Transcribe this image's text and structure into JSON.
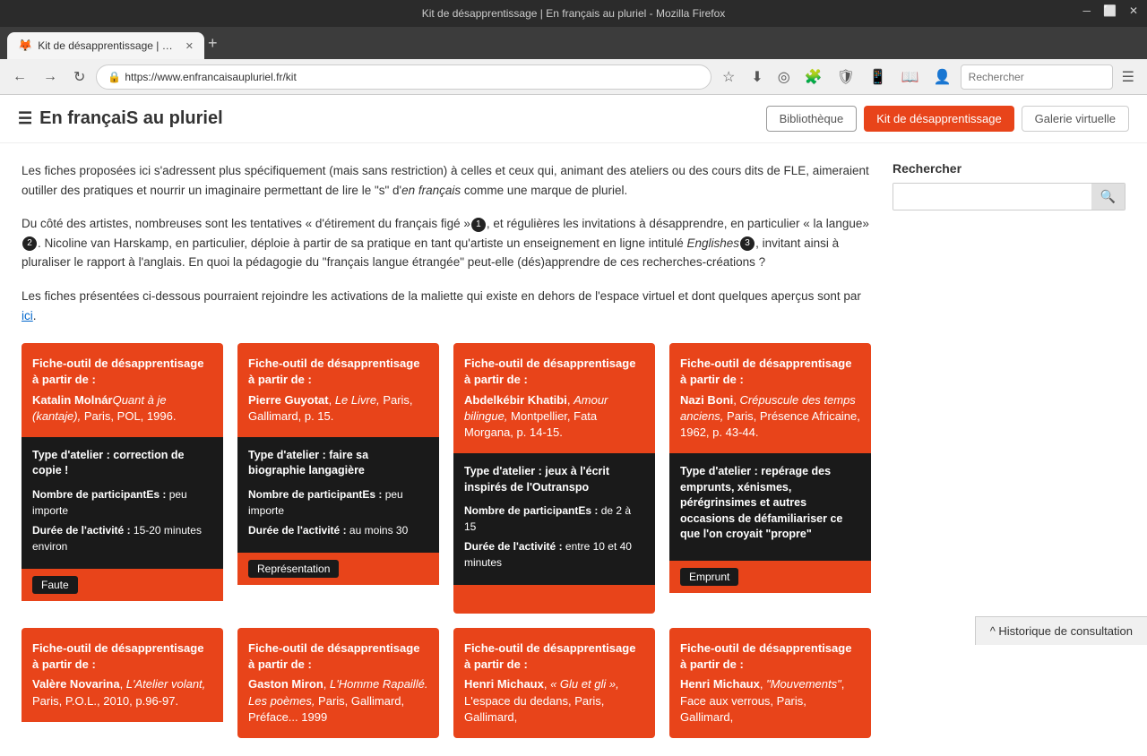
{
  "browser": {
    "titlebar_text": "Kit de désapprentissage | En français au pluriel - Mozilla Firefox",
    "tab_label": "Kit de désapprentissage | En ...",
    "address": "https://www.enfrancaisaupluriel.fr/kit",
    "search_placeholder": "Rechercher"
  },
  "site": {
    "title": "En françaiS au pluriel",
    "nav": [
      {
        "label": "Bibliothèque",
        "style": "outline"
      },
      {
        "label": "Kit de désapprentissage",
        "style": "active"
      },
      {
        "label": "Galerie virtuelle",
        "style": "outline"
      }
    ]
  },
  "intro": {
    "paragraph1": "Les fiches proposées ici s'adressent plus spécifiquement (mais sans restriction) à celles et ceux qui, animant des ateliers ou des cours dits de FLE, aimeraient outiller des pratiques et nourrir un imaginaire permettant de lire le \"s\" d'",
    "italic1": "en français",
    "paragraph1b": " comme une marque de pluriel.",
    "paragraph2a": "Du côté des artistes, nombreuses sont les tentatives « d'étirement du français figé »",
    "footnote1": "1",
    "paragraph2b": ", et régulières les invitations à désapprendre, en particulier « la langue»",
    "footnote2": "2",
    "paragraph2c": ". Nicoline van Harskamp, en particulier, déploie à partir de sa pratique en tant qu'artiste un enseignement en ligne intitulé ",
    "italic2": "Englishes",
    "footnote3": "3",
    "paragraph2d": ", invitant ainsi à pluraliser le rapport à l'anglais. En quoi la pédagogie du \"français langue étrangée\" peut-elle (dés)apprendre de ces recherches-créations ?",
    "paragraph3a": "Les fiches présentées ci-dessous pourraient rejoindre les activations de la maliette qui existe en dehors de l'espace virtuel et dont quelques aperçus sont par ",
    "link": "ici",
    "paragraph3b": "."
  },
  "sidebar": {
    "search_label": "Rechercher",
    "search_placeholder": ""
  },
  "cards_row1": [
    {
      "title": "Fiche-outil de désapprentisage à partir de :",
      "author_bold": "Katalin Molnár",
      "author_italic": "Quant à je (kantaje),",
      "author_rest": " Paris, POL, 1996.",
      "type": "Type d'atelier : correction de copie !",
      "info1_bold": "Nombre de participantEs :",
      "info1_rest": " peu importe",
      "info2_bold": "Durée de l'activité :",
      "info2_rest": " 15-20 minutes environ",
      "tag": "Faute"
    },
    {
      "title": "Fiche-outil de désapprentisage à partir de :",
      "author_bold": "Pierre Guyotat",
      "author_italic": "Le Livre,",
      "author_rest": " Paris, Gallimard, p. 15.",
      "type": "Type d'atelier : faire sa biographie langagière",
      "info1_bold": "Nombre de participantEs :",
      "info1_rest": " peu importe",
      "info2_bold": "Durée de l'activité :",
      "info2_rest": " au moins 30",
      "tag": "Représentation"
    },
    {
      "title": "Fiche-outil de désapprentisage à partir de :",
      "author_bold": "Abdelkébir Khatibi",
      "author_italic": "Amour bilingue,",
      "author_rest": " Montpellier, Fata Morgana, p. 14-15.",
      "type": "Type d'atelier : jeux à l'écrit inspirés de l'Outranspo",
      "info1_bold": "Nombre de participantEs :",
      "info1_rest": " de 2 à 15",
      "info2_bold": "Durée de l'activité :",
      "info2_rest": " entre 10 et 40 minutes",
      "tag": ""
    },
    {
      "title": "Fiche-outil de désapprentisage à partir de :",
      "author_bold": "Nazi Boni",
      "author_italic": "Crépuscule des temps anciens,",
      "author_rest": " Paris, Présence Africaine, 1962, p. 43-44.",
      "type": "Type d'atelier : repérage des emprunts, xénismes, pérégrinsimes et autres occasions de défamiliariser ce que l'on croyait \"propre\"",
      "info1_bold": "",
      "info1_rest": "",
      "info2_bold": "",
      "info2_rest": "",
      "tag": "Emprunt"
    }
  ],
  "cards_row2": [
    {
      "title": "Fiche-outil de désapprentisage à partir de :",
      "author_bold": "Valère Novarina",
      "author_italic": "L'Atelier volant,",
      "author_rest": " Paris, P.O.L., 2010, p.96-97.",
      "type": "",
      "info1_bold": "",
      "info1_rest": "",
      "info2_bold": "",
      "info2_rest": "",
      "tag": ""
    },
    {
      "title": "Fiche-outil de désapprentisage à partir de :",
      "author_bold": "Gaston Miron",
      "author_italic": "L'Homme Rapaillé. Les poèmes,",
      "author_rest": " Paris, Gallimard, Préface... 1999",
      "type": "",
      "info1_bold": "",
      "info1_rest": "",
      "info2_bold": "",
      "info2_rest": "",
      "tag": ""
    },
    {
      "title": "Fiche-outil de désapprentisage à partir de :",
      "author_bold": "Henri Michaux",
      "author_italic": "« Glu et gli »,",
      "author_rest": " L'espace du dedans, Paris, Gallimard,",
      "type": "",
      "info1_bold": "",
      "info1_rest": "",
      "info2_bold": "",
      "info2_rest": "",
      "tag": ""
    },
    {
      "title": "Fiche-outil de désapprentisage à partir de :",
      "author_bold": "Henri Michaux",
      "author_italic": "\"Mouvements\"",
      "author_rest": ", Face aux verrous,  Paris, Gallimard,",
      "type": "",
      "info1_bold": "",
      "info1_rest": "",
      "info2_bold": "",
      "info2_rest": "",
      "tag": ""
    }
  ],
  "history_bar": {
    "label": "^ Historique de consultation"
  }
}
